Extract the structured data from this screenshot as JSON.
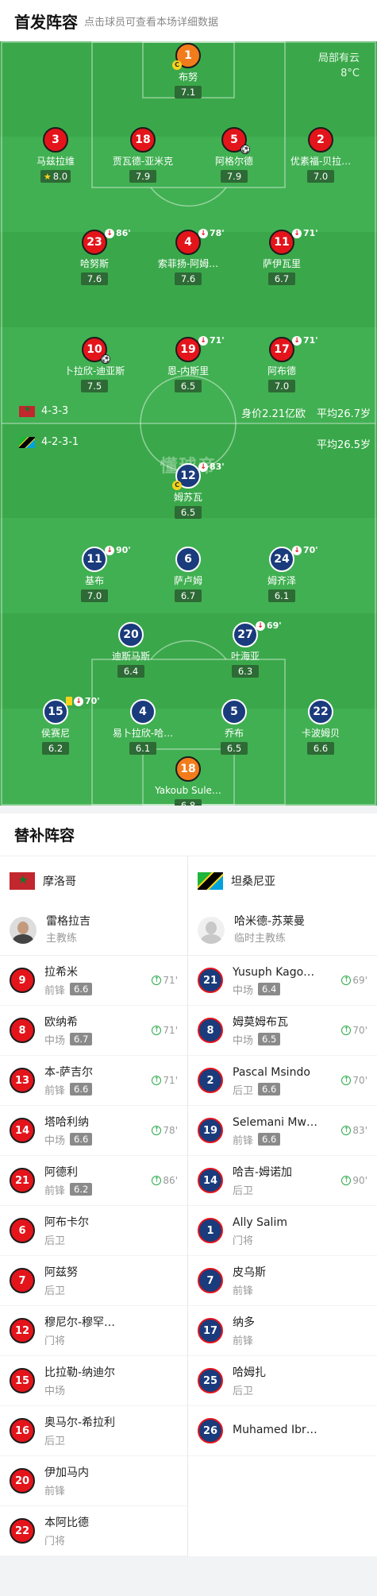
{
  "header": {
    "title": "首发阵容",
    "subtitle": "点击球员可查看本场详细数据"
  },
  "weather": {
    "condition": "局部有云",
    "temp": "8°C"
  },
  "watermark": "懂球帝",
  "home": {
    "formation": "4-3-3",
    "value": "身价2.21亿欧",
    "age": "平均26.7岁",
    "players": {
      "p1": {
        "num": "1",
        "name": "布努",
        "rating": "7.1"
      },
      "p3": {
        "num": "3",
        "name": "马兹拉维",
        "rating": "8.0"
      },
      "p18": {
        "num": "18",
        "name": "贾瓦德-亚米克",
        "rating": "7.9"
      },
      "p5": {
        "num": "5",
        "name": "阿格尔德",
        "rating": "7.9"
      },
      "p2": {
        "num": "2",
        "name": "优素福-贝拉…",
        "rating": "7.0"
      },
      "p23": {
        "num": "23",
        "name": "哈努斯",
        "rating": "7.6",
        "sub": "86'"
      },
      "p4": {
        "num": "4",
        "name": "索菲扬-阿姆…",
        "rating": "7.6",
        "sub": "78'"
      },
      "p11": {
        "num": "11",
        "name": "萨伊瓦里",
        "rating": "6.7",
        "sub": "71'"
      },
      "p10": {
        "num": "10",
        "name": "卜拉欣-迪亚斯",
        "rating": "7.5"
      },
      "p19": {
        "num": "19",
        "name": "恩-内斯里",
        "rating": "6.5",
        "sub": "71'"
      },
      "p17": {
        "num": "17",
        "name": "阿布德",
        "rating": "7.0",
        "sub": "71'"
      }
    }
  },
  "away": {
    "formation": "4-2-3-1",
    "age": "平均26.5岁",
    "players": {
      "p12": {
        "num": "12",
        "name": "姆苏瓦",
        "rating": "6.5",
        "sub": "83'"
      },
      "p11": {
        "num": "11",
        "name": "基布",
        "rating": "7.0",
        "sub": "90'"
      },
      "p6": {
        "num": "6",
        "name": "萨卢姆",
        "rating": "6.7"
      },
      "p24": {
        "num": "24",
        "name": "姆齐泽",
        "rating": "6.1",
        "sub": "70'"
      },
      "p20": {
        "num": "20",
        "name": "迪斯马斯",
        "rating": "6.4"
      },
      "p27": {
        "num": "27",
        "name": "叶海亚",
        "rating": "6.3",
        "sub": "69'"
      },
      "p15": {
        "num": "15",
        "name": "侯赛尼",
        "rating": "6.2",
        "sub": "70'"
      },
      "p4": {
        "num": "4",
        "name": "易卜拉欣-哈…",
        "rating": "6.1"
      },
      "p5": {
        "num": "5",
        "name": "乔布",
        "rating": "6.5"
      },
      "p22": {
        "num": "22",
        "name": "卡波姆贝",
        "rating": "6.6"
      },
      "p18": {
        "num": "18",
        "name": "Yakoub Sule…",
        "rating": "6.8"
      }
    }
  },
  "subs": {
    "title": "替补阵容",
    "home": {
      "team": "摩洛哥",
      "coach": {
        "name": "雷格拉吉",
        "role": "主教练"
      },
      "list": [
        {
          "num": "9",
          "name": "拉希米",
          "pos": "前锋",
          "rating": "6.6",
          "in": "71'"
        },
        {
          "num": "8",
          "name": "欧纳希",
          "pos": "中场",
          "rating": "6.7",
          "in": "71'"
        },
        {
          "num": "13",
          "name": "本-萨吉尔",
          "pos": "前锋",
          "rating": "6.6",
          "in": "71'"
        },
        {
          "num": "14",
          "name": "塔哈利纳",
          "pos": "中场",
          "rating": "6.6",
          "in": "78'"
        },
        {
          "num": "21",
          "name": "阿德利",
          "pos": "前锋",
          "rating": "6.2",
          "in": "86'"
        },
        {
          "num": "6",
          "name": "阿布卡尔",
          "pos": "后卫"
        },
        {
          "num": "7",
          "name": "阿兹努",
          "pos": "后卫"
        },
        {
          "num": "12",
          "name": "穆尼尔-穆罕…",
          "pos": "门将"
        },
        {
          "num": "15",
          "name": "比拉勒-纳迪尔",
          "pos": "中场"
        },
        {
          "num": "16",
          "name": "奥马尔-希拉利",
          "pos": "后卫"
        },
        {
          "num": "20",
          "name": "伊加马内",
          "pos": "前锋"
        },
        {
          "num": "22",
          "name": "本阿比德",
          "pos": "门将"
        }
      ]
    },
    "away": {
      "team": "坦桑尼亚",
      "coach": {
        "name": "哈米德-苏莱曼",
        "role": "临时主教练"
      },
      "list": [
        {
          "num": "21",
          "name": "Yusuph Kago…",
          "pos": "中场",
          "rating": "6.4",
          "in": "69'"
        },
        {
          "num": "8",
          "name": "姆莫姆布瓦",
          "pos": "中场",
          "rating": "6.5",
          "in": "70'"
        },
        {
          "num": "2",
          "name": "Pascal Msindo",
          "pos": "后卫",
          "rating": "6.6",
          "in": "70'"
        },
        {
          "num": "19",
          "name": "Selemani Mw…",
          "pos": "前锋",
          "rating": "6.6",
          "in": "83'"
        },
        {
          "num": "14",
          "name": "哈吉-姆诺加",
          "pos": "后卫",
          "in": "90'"
        },
        {
          "num": "1",
          "name": "Ally Salim",
          "pos": "门将"
        },
        {
          "num": "7",
          "name": "皮乌斯",
          "pos": "前锋"
        },
        {
          "num": "17",
          "name": "纳多",
          "pos": "前锋"
        },
        {
          "num": "25",
          "name": "哈姆扎",
          "pos": "后卫"
        },
        {
          "num": "26",
          "name": "Muhamed Ibr…",
          "pos": ""
        }
      ]
    }
  },
  "colors": {
    "pitch": "#3aa84a",
    "home": "#e4141b",
    "away": "#1a3b7c",
    "gk": "#f27c1c"
  }
}
